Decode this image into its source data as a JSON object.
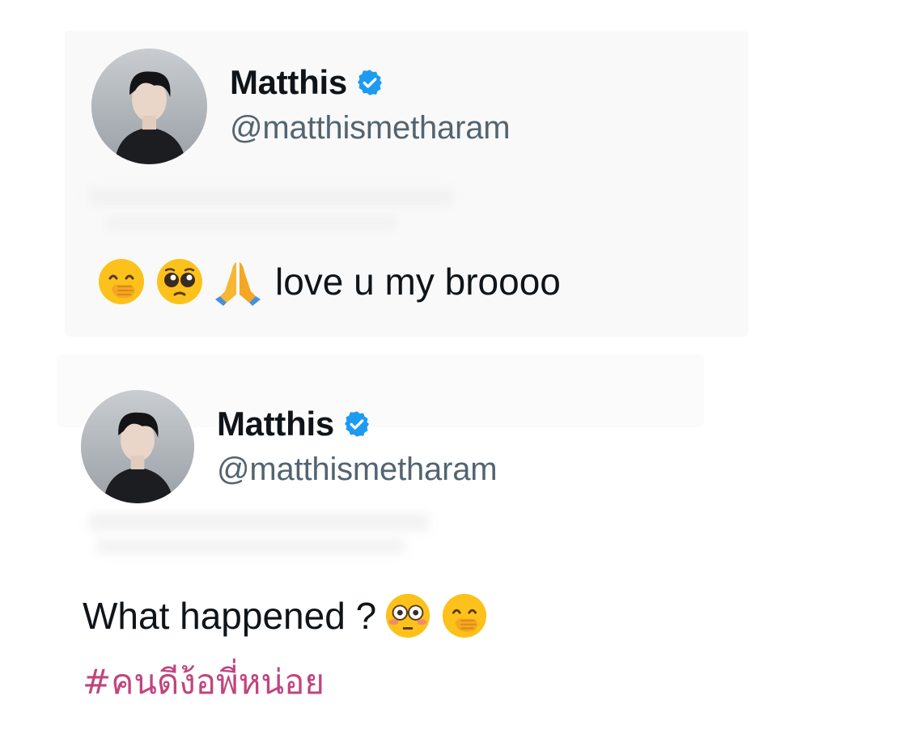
{
  "tweets": [
    {
      "author": {
        "display_name": "Matthis",
        "handle": "@matthismetharam",
        "verified": true,
        "avatar_icon": "profile-photo"
      },
      "emojis": [
        "hand-over-mouth-emoji",
        "pleading-face-emoji",
        "folded-hands-emoji"
      ],
      "text": "love u my broooo"
    },
    {
      "author": {
        "display_name": "Matthis",
        "handle": "@matthismetharam",
        "verified": true,
        "avatar_icon": "profile-photo"
      },
      "text": "What happened ?",
      "emojis": [
        "flushed-face-emoji",
        "hand-over-mouth-emoji"
      ],
      "hashtag": "#คนดีง้อพี่หน่อย"
    }
  ],
  "colors": {
    "text_primary": "#0f1419",
    "text_secondary": "#536471",
    "verified_blue": "#1d9bf0",
    "hashtag_pink": "#c0457f"
  }
}
